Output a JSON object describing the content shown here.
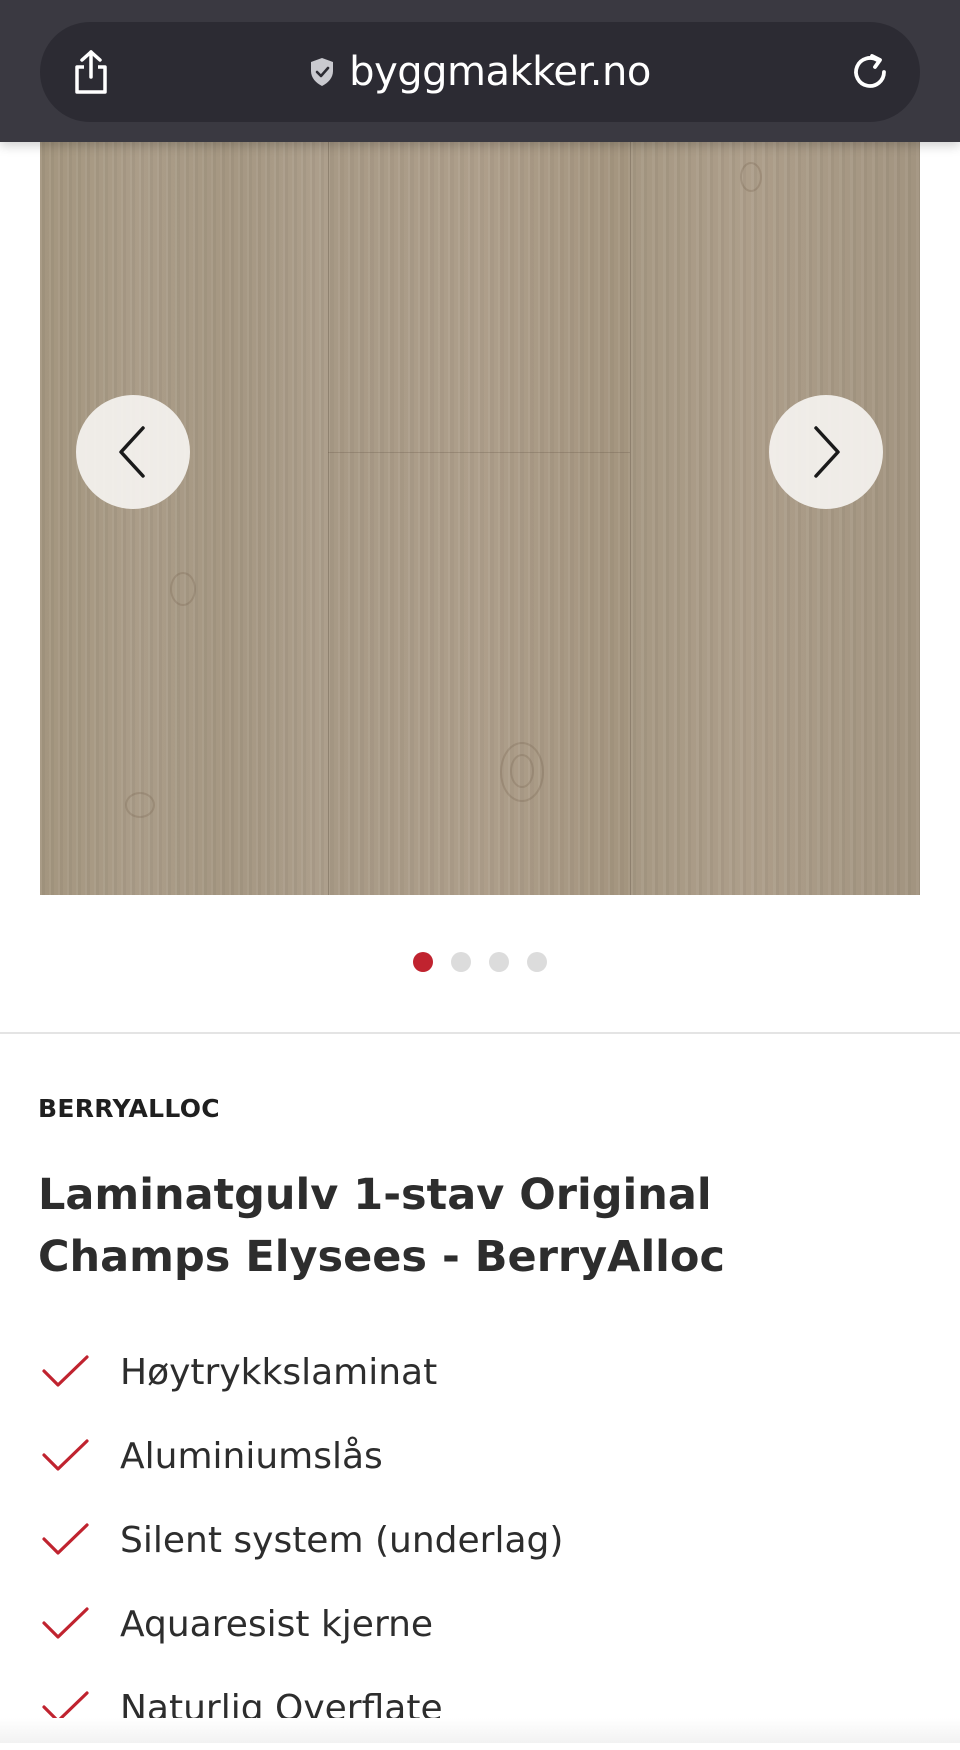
{
  "browser": {
    "url": "byggmakker.no",
    "icons": {
      "share": "share-icon",
      "secure": "shield-check-icon",
      "reload": "reload-icon"
    }
  },
  "gallery": {
    "image_alt": "laminate-floor-texture",
    "prev_icon": "chevron-left-icon",
    "next_icon": "chevron-right-icon",
    "slides_total": 4,
    "active_slide": 1
  },
  "product": {
    "brand": "BERRYALLOC",
    "title": "Laminatgulv 1-stav Original Champs Elysees - BerryAlloc",
    "features": [
      "Høytrykkslaminat",
      "Aluminiumslås",
      "Silent system (underlag)",
      "Aquaresist kjerne",
      "Naturlig Overflate"
    ]
  },
  "colors": {
    "accent": "#c0232f",
    "browser_bar": "#3a3941",
    "text": "#2d2d2d"
  }
}
